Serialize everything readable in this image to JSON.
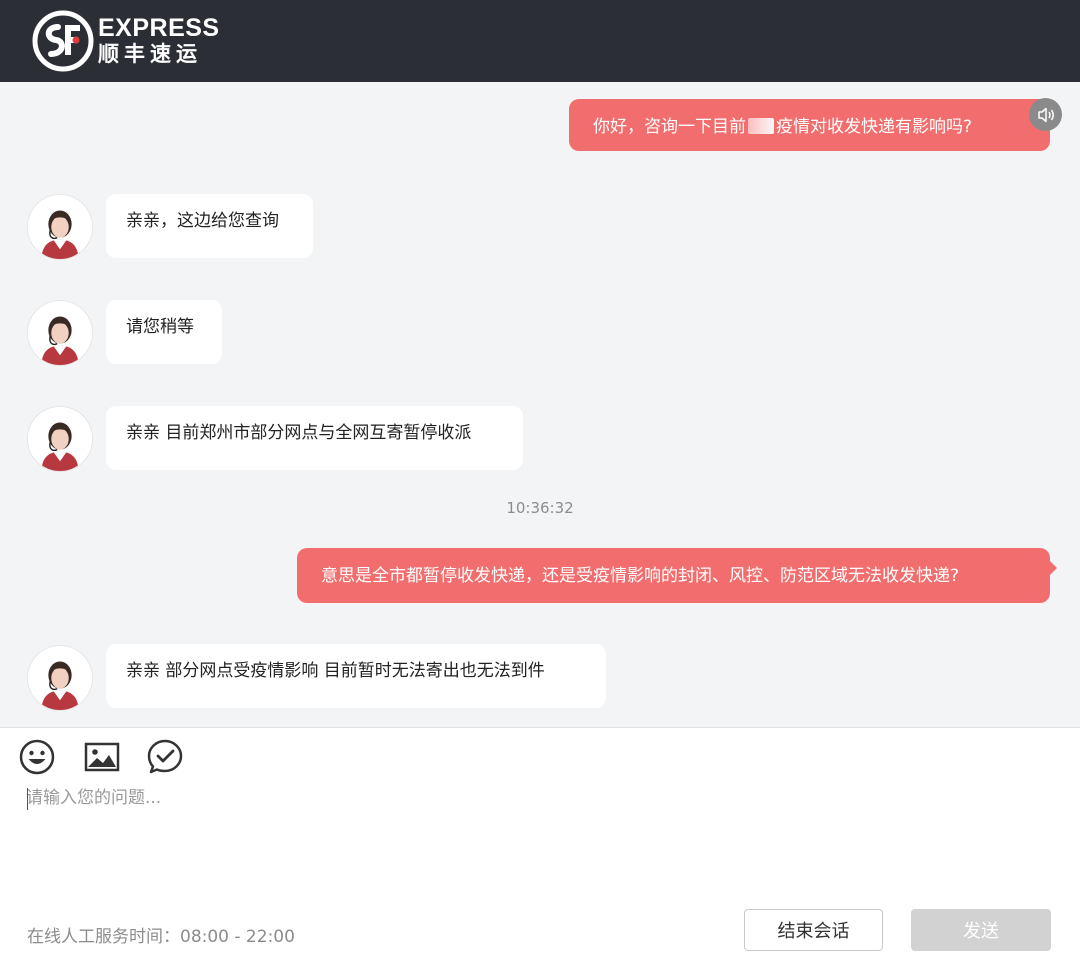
{
  "header": {
    "logo_en": "EXPRESS",
    "logo_cn": "顺丰速运",
    "colors": {
      "bar": "#2b2f35"
    }
  },
  "chat": {
    "messages": [
      {
        "from": "user",
        "text_before": "你好，咨询一下目前",
        "text_after": "疫情对收发快递有影响吗?"
      },
      {
        "from": "agent",
        "text": "亲亲，这边给您查询"
      },
      {
        "from": "agent",
        "text": "请您稍等"
      },
      {
        "from": "agent",
        "text": "亲亲  目前郑州市部分网点与全网互寄暂停收派"
      },
      {
        "from": "user",
        "text": "意思是全市都暂停收发快递，还是受疫情影响的封闭、风控、防范区域无法收发快递?"
      },
      {
        "from": "agent",
        "text": "亲亲   部分网点受疫情影响 目前暂时无法寄出也无法到件"
      }
    ],
    "timestamp": "10:36:32",
    "colors": {
      "user_bubble": "#f26e6e",
      "agent_bubble": "#ffffff",
      "background": "#f3f4f6"
    },
    "icons": {
      "speaker": "speaker-icon",
      "avatar": "agent-avatar"
    }
  },
  "composer": {
    "tools": [
      "emoji-icon",
      "image-icon",
      "check-icon"
    ],
    "placeholder": "请输入您的问题...",
    "service_hours": "在线人工服务时间：08:00 - 22:00",
    "end_button": "结束会话",
    "send_button": "发送"
  }
}
